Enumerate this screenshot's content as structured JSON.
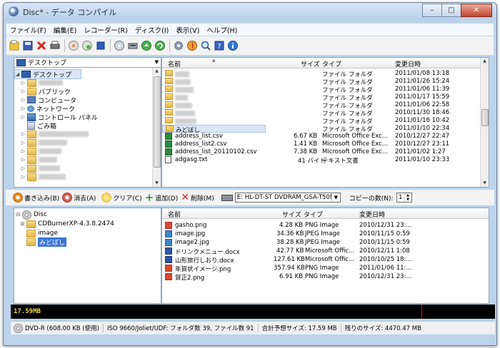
{
  "window": {
    "title": "Disc* - データ コンパイル",
    "controls": {
      "minimize": "–",
      "maximize": "□",
      "close": "✕"
    }
  },
  "menu": [
    "ファイル(F)",
    "編集(E)",
    "レコーダー(R)",
    "ディスク(I)",
    "表示(V)",
    "ヘルプ(H)"
  ],
  "toolbar_icons": [
    "new-icon",
    "save-icon",
    "delete-icon",
    "print-icon",
    "burn-icon",
    "erase-icon",
    "stop-icon",
    "disc-icon",
    "drive-icon",
    "eject-icon",
    "refresh-icon",
    "settings-icon",
    "burn-progress-icon",
    "search-icon",
    "help-icon",
    "info-icon"
  ],
  "folder_tree": {
    "combo": "デスクトップ",
    "items": [
      {
        "label": "デスクトップ",
        "level": 0,
        "type": "desktop"
      },
      {
        "label": "",
        "level": 1,
        "type": "user",
        "blurred": true
      },
      {
        "label": "パブリック",
        "level": 1,
        "type": "folder"
      },
      {
        "label": "コンピュータ",
        "level": 1,
        "type": "computer"
      },
      {
        "label": "ネットワーク",
        "level": 1,
        "type": "network"
      },
      {
        "label": "コントロール パネル",
        "level": 1,
        "type": "control"
      },
      {
        "label": "ごみ箱",
        "level": 1,
        "type": "recycle"
      },
      {
        "label": "",
        "level": 1,
        "type": "folder",
        "blurred": true
      },
      {
        "label": "",
        "level": 1,
        "type": "folder",
        "blurred": true
      },
      {
        "label": "",
        "level": 1,
        "type": "folder",
        "blurred": true
      },
      {
        "label": "",
        "level": 1,
        "type": "folder",
        "blurred": true
      },
      {
        "label": "",
        "level": 1,
        "type": "folder",
        "blurred": true
      },
      {
        "label": "",
        "level": 1,
        "type": "folder",
        "blurred": true
      }
    ]
  },
  "file_list": {
    "columns": {
      "name": "名前",
      "size": "サイズ",
      "type": "タイプ",
      "modified": "変更日時"
    },
    "rows": [
      {
        "name": "",
        "size": "",
        "type": "ファイル フォルダ",
        "modified": "2011/01/08 13:18",
        "kind": "folder",
        "blurred": true
      },
      {
        "name": "",
        "size": "",
        "type": "ファイル フォルダ",
        "modified": "2011/01/26 15:24",
        "kind": "folder",
        "blurred": true
      },
      {
        "name": "",
        "size": "",
        "type": "ファイル フォルダ",
        "modified": "2011/01/06 11:39",
        "kind": "folder",
        "blurred": true
      },
      {
        "name": "",
        "size": "",
        "type": "ファイル フォルダ",
        "modified": "2011/01/17 15:59",
        "kind": "folder",
        "blurred": true
      },
      {
        "name": "",
        "size": "",
        "type": "ファイル フォルダ",
        "modified": "2011/01/06 22:58",
        "kind": "folder",
        "blurred": true
      },
      {
        "name": "",
        "size": "",
        "type": "ファイル フォルダ",
        "modified": "2010/11/30 18:46",
        "kind": "folder",
        "blurred": true
      },
      {
        "name": "",
        "size": "",
        "type": "ファイル フォルダ",
        "modified": "2011/01/16 10:42",
        "kind": "folder",
        "blurred": true
      },
      {
        "name": "みどぼし",
        "size": "",
        "type": "ファイル フォルダ",
        "modified": "2011/01/10 22:34",
        "kind": "folder",
        "selected": true
      },
      {
        "name": "address_list.csv",
        "size": "6.67 KB",
        "type": "Microsoft Office Exc...",
        "modified": "2010/12/27 22:47",
        "kind": "csv"
      },
      {
        "name": "address_list2.csv",
        "size": "1.41 KB",
        "type": "Microsoft Office Exc...",
        "modified": "2010/12/27 23:11",
        "kind": "csv"
      },
      {
        "name": "address_list_20110102.csv",
        "size": "7.38 KB",
        "type": "Microsoft Office Exc...",
        "modified": "2011/01/02 1:27",
        "kind": "csv"
      },
      {
        "name": "adgasg.txt",
        "size": "41 バイト",
        "type": "テキスト文書",
        "modified": "2011/01/10 23:33",
        "kind": "txt"
      }
    ]
  },
  "actions": {
    "write": "書き込み(B)",
    "erase": "消去(A)",
    "clear": "クリア(C)",
    "add": "追加(D)",
    "remove": "削除(M)",
    "drive": "E: HL-DT-ST DVDRAM_GSA-T50N",
    "copies_label": "コピーの数(N):",
    "copies_value": "1"
  },
  "disc_tree": {
    "items": [
      {
        "label": "Disc",
        "level": 0,
        "type": "disc"
      },
      {
        "label": "CDBurnerXP-4.3.8.2474",
        "level": 1,
        "type": "folder"
      },
      {
        "label": "image",
        "level": 1,
        "type": "folder"
      },
      {
        "label": "みどぼし",
        "level": 1,
        "type": "folder",
        "selected": true
      }
    ]
  },
  "disc_files": {
    "columns": {
      "name": "名前",
      "size": "サイズ",
      "type": "タイプ",
      "modified": "変更日時"
    },
    "rows": [
      {
        "name": "gasho.png",
        "size": "4.28 KB",
        "type": "PNG Image",
        "modified": "2010/12/31 23:...",
        "kind": "png"
      },
      {
        "name": "image.jpg",
        "size": "34.36 KB",
        "type": "JPEG Image",
        "modified": "2010/11/15 0:59",
        "kind": "jpg"
      },
      {
        "name": "image2.jpg",
        "size": "38.28 KB",
        "type": "JPEG Image",
        "modified": "2010/11/15 0:59",
        "kind": "jpg"
      },
      {
        "name": "ドリンクメニュー.docx",
        "size": "42.77 KB",
        "type": "Microsoft Offic...",
        "modified": "2010/12/11 1:08",
        "kind": "doc"
      },
      {
        "name": "山形旅行しおり.docx",
        "size": "127.61 KB",
        "type": "Microsoft Offic...",
        "modified": "2010/10/25 18:...",
        "kind": "doc"
      },
      {
        "name": "年賀状イメージ.png",
        "size": "357.94 KB",
        "type": "PNG Image",
        "modified": "2011/01/06 11:...",
        "kind": "png"
      },
      {
        "name": "賀正2.png",
        "size": "6.91 KB",
        "type": "PNG Image",
        "modified": "2010/12/31 23:...",
        "kind": "png"
      }
    ]
  },
  "capacity": {
    "label": "17.59MB",
    "used_fraction": 0.004
  },
  "status": {
    "media": "DVD-R (608.00 KB (使用)",
    "fs": "ISO 9660/Joliet/UDF: フォルダ数 39, ファイル数 91",
    "total": "合計予想サイズ: 17.59 MB",
    "remaining": "残りのサイズ: 4470.47 MB"
  }
}
